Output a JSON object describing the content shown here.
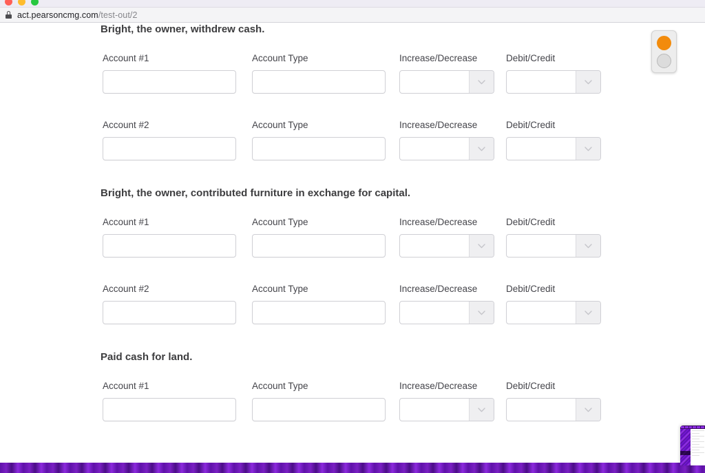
{
  "browser": {
    "traffic_lights": [
      "close",
      "minimize",
      "zoom"
    ],
    "url_host": "act.pearsoncmg.com",
    "url_path": "/test-out/2",
    "lock_icon": "lock-icon",
    "tab_ghost_left": "",
    "tab_ghost_right": ""
  },
  "labels": {
    "account_1": "Account #1",
    "account_2": "Account #2",
    "account_type": "Account Type",
    "increase_decrease": "Increase/Decrease",
    "debit_credit": "Debit/Credit"
  },
  "placeholders": {
    "account": "",
    "account_type": "",
    "increase_decrease": "",
    "debit_credit": ""
  },
  "clipped_row": {
    "account_value": "",
    "account_type_value": "",
    "increase_decrease_value": "",
    "debit_credit_value": ""
  },
  "transactions": [
    {
      "title": "Bright, the owner, withdrew cash.",
      "rows": [
        {
          "row_label": "Account #1",
          "account_value": "",
          "account_type_label": "Account Type",
          "account_type_value": "",
          "increase_decrease_label": "Increase/Decrease",
          "increase_decrease_value": "",
          "debit_credit_label": "Debit/Credit",
          "debit_credit_value": ""
        },
        {
          "row_label": "Account #2",
          "account_value": "",
          "account_type_label": "Account Type",
          "account_type_value": "",
          "increase_decrease_label": "Increase/Decrease",
          "increase_decrease_value": "",
          "debit_credit_label": "Debit/Credit",
          "debit_credit_value": ""
        }
      ]
    },
    {
      "title": "Bright, the owner, contributed furniture in exchange for capital.",
      "rows": [
        {
          "row_label": "Account #1",
          "account_value": "",
          "account_type_label": "Account Type",
          "account_type_value": "",
          "increase_decrease_label": "Increase/Decrease",
          "increase_decrease_value": "",
          "debit_credit_label": "Debit/Credit",
          "debit_credit_value": ""
        },
        {
          "row_label": "Account #2",
          "account_value": "",
          "account_type_label": "Account Type",
          "account_type_value": "",
          "increase_decrease_label": "Increase/Decrease",
          "increase_decrease_value": "",
          "debit_credit_label": "Debit/Credit",
          "debit_credit_value": ""
        }
      ]
    },
    {
      "title": "Paid cash for land.",
      "rows": [
        {
          "row_label": "Account #1",
          "account_value": "",
          "account_type_label": "Account Type",
          "account_type_value": "",
          "increase_decrease_label": "Increase/Decrease",
          "increase_decrease_value": "",
          "debit_credit_label": "Debit/Credit",
          "debit_credit_value": ""
        }
      ]
    }
  ],
  "recorder": {
    "record_dot": "record-dot",
    "stop_dot": "stop-dot",
    "record_color": "#f28b0c",
    "stop_color": "#dcdcdc"
  },
  "thumbnail": {
    "name": "window-preview"
  },
  "colors": {
    "page_background": "#ffffff",
    "field_border": "#cfcfd4",
    "dropdown_button": "#efeff1",
    "label_text": "#44444a",
    "title_text": "#3d3d3f",
    "url_host_text": "#222226",
    "url_path_text": "#86868b",
    "desktop_purple": "#5e11a8"
  }
}
